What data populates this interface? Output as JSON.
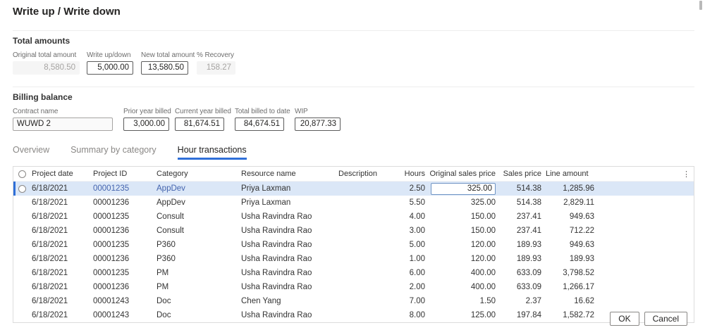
{
  "title": "Write up / Write down",
  "total_amounts": {
    "heading": "Total amounts",
    "fields": [
      {
        "label": "Original total amount",
        "value": "8,580.50",
        "disabled": true
      },
      {
        "label": "Write up/down",
        "value": "5,000.00",
        "disabled": false
      },
      {
        "label": "New total amount",
        "value": "13,580.50",
        "disabled": false
      },
      {
        "label": "% Recovery",
        "value": "158.27",
        "disabled": true
      }
    ]
  },
  "billing_balance": {
    "heading": "Billing balance",
    "fields": [
      {
        "label": "Contract name",
        "value": "WUWD 2",
        "disabled": true
      },
      {
        "label": "Prior year billed",
        "value": "3,000.00",
        "disabled": false
      },
      {
        "label": "Current year billed",
        "value": "81,674.51",
        "disabled": false
      },
      {
        "label": "Total billed to date",
        "value": "84,674.51",
        "disabled": false
      },
      {
        "label": "WIP",
        "value": "20,877.33",
        "disabled": false
      }
    ]
  },
  "tabs": [
    {
      "label": "Overview",
      "active": false
    },
    {
      "label": "Summary by category",
      "active": false
    },
    {
      "label": "Hour transactions",
      "active": true
    }
  ],
  "grid": {
    "more_icon": "⋮",
    "columns": [
      "Project date",
      "Project ID",
      "Category",
      "Resource name",
      "Description",
      "Hours",
      "Original sales price",
      "Sales price",
      "Line amount"
    ],
    "rows": [
      {
        "selected": true,
        "date": "6/18/2021",
        "id": "00001235",
        "category": "AppDev",
        "resource": "Priya Laxman",
        "description": "",
        "hours": "2.50",
        "original_sales_price": "325.00",
        "sales_price": "514.38",
        "line_amount": "1,285.96"
      },
      {
        "selected": false,
        "date": "6/18/2021",
        "id": "00001236",
        "category": "AppDev",
        "resource": "Priya Laxman",
        "description": "",
        "hours": "5.50",
        "original_sales_price": "325.00",
        "sales_price": "514.38",
        "line_amount": "2,829.11"
      },
      {
        "selected": false,
        "date": "6/18/2021",
        "id": "00001235",
        "category": "Consult",
        "resource": "Usha Ravindra Rao",
        "description": "",
        "hours": "4.00",
        "original_sales_price": "150.00",
        "sales_price": "237.41",
        "line_amount": "949.63"
      },
      {
        "selected": false,
        "date": "6/18/2021",
        "id": "00001236",
        "category": "Consult",
        "resource": "Usha Ravindra Rao",
        "description": "",
        "hours": "3.00",
        "original_sales_price": "150.00",
        "sales_price": "237.41",
        "line_amount": "712.22"
      },
      {
        "selected": false,
        "date": "6/18/2021",
        "id": "00001235",
        "category": "P360",
        "resource": "Usha Ravindra Rao",
        "description": "",
        "hours": "5.00",
        "original_sales_price": "120.00",
        "sales_price": "189.93",
        "line_amount": "949.63"
      },
      {
        "selected": false,
        "date": "6/18/2021",
        "id": "00001236",
        "category": "P360",
        "resource": "Usha Ravindra Rao",
        "description": "",
        "hours": "1.00",
        "original_sales_price": "120.00",
        "sales_price": "189.93",
        "line_amount": "189.93"
      },
      {
        "selected": false,
        "date": "6/18/2021",
        "id": "00001235",
        "category": "PM",
        "resource": "Usha Ravindra Rao",
        "description": "",
        "hours": "6.00",
        "original_sales_price": "400.00",
        "sales_price": "633.09",
        "line_amount": "3,798.52"
      },
      {
        "selected": false,
        "date": "6/18/2021",
        "id": "00001236",
        "category": "PM",
        "resource": "Usha Ravindra Rao",
        "description": "",
        "hours": "2.00",
        "original_sales_price": "400.00",
        "sales_price": "633.09",
        "line_amount": "1,266.17"
      },
      {
        "selected": false,
        "date": "6/18/2021",
        "id": "00001243",
        "category": "Doc",
        "resource": "Chen Yang",
        "description": "",
        "hours": "7.00",
        "original_sales_price": "1.50",
        "sales_price": "2.37",
        "line_amount": "16.62"
      },
      {
        "selected": false,
        "date": "6/18/2021",
        "id": "00001243",
        "category": "Doc",
        "resource": "Usha Ravindra Rao",
        "description": "",
        "hours": "8.00",
        "original_sales_price": "125.00",
        "sales_price": "197.84",
        "line_amount": "1,582.72"
      }
    ]
  },
  "footer": {
    "ok": "OK",
    "cancel": "Cancel"
  },
  "colors": {
    "accent": "#2f6fd8",
    "selected_row_bg": "#dbe7f7",
    "link": "#4464ae",
    "disabled_text": "#a6a4a2"
  }
}
